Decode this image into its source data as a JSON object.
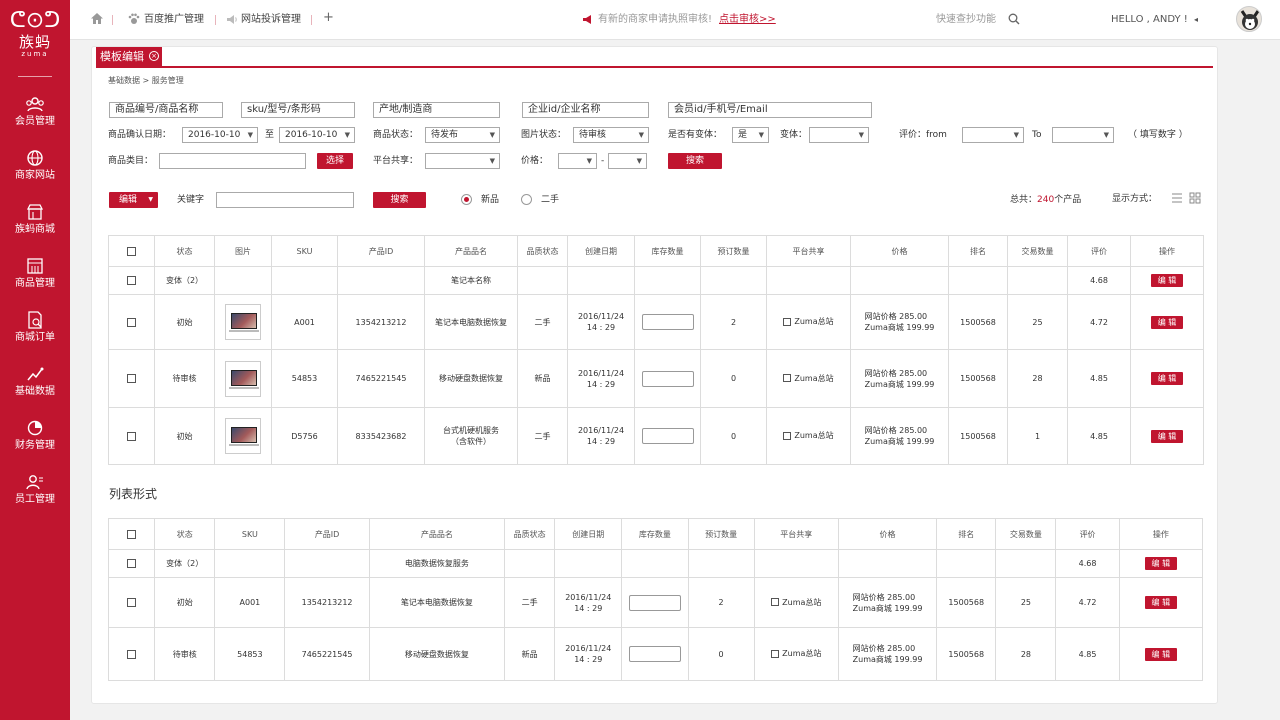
{
  "sidebar": {
    "logo": {
      "mark": "ᕦ⊙ᕤ",
      "name": "族蚂",
      "sub": "zuma"
    },
    "items": [
      {
        "label": "会员管理",
        "icon": "members-icon"
      },
      {
        "label": "商家网站",
        "icon": "globe-icon"
      },
      {
        "label": "族蚂商城",
        "icon": "mall-icon"
      },
      {
        "label": "商品管理",
        "icon": "grid-icon"
      },
      {
        "label": "商城订单",
        "icon": "order-icon"
      },
      {
        "label": "基础数据",
        "icon": "chart-icon"
      },
      {
        "label": "财务管理",
        "icon": "pie-icon"
      },
      {
        "label": "员工管理",
        "icon": "staff-icon"
      }
    ]
  },
  "topbar": {
    "nav1": "百度推广管理",
    "nav2": "网站投诉管理",
    "plus": "+",
    "notice": "有新的商家申请执照审核!",
    "notice_link": "点击审核>>",
    "search_placeholder": "快速查抄功能",
    "greeting": "HELLO , ANDY !",
    "colors": {
      "brand": "#c0152f"
    }
  },
  "tab": {
    "label": "模板编辑",
    "close": "×"
  },
  "breadcrumb": "基础数据 > 服务管理",
  "filters": {
    "search1": "商品编号/商品名称",
    "search2": "sku/型号/条形码",
    "search3": "产地/制造商",
    "search4": "企业id/企业名称",
    "search5": "会员id/手机号/Email",
    "confirm_date_label": "商品确认日期：",
    "date_from": "2016-10-10",
    "date_to_sep": "至",
    "date_to": "2016-10-10",
    "status_label": "商品状态：",
    "status_value": "待发布",
    "image_status_label": "图片状态：",
    "image_status_value": "待审核",
    "variant_label": "是否有变体：",
    "variant_value": "是",
    "variant2_label": "变体：",
    "variant2_value": "",
    "rating_label": "评价：from",
    "rating_from": "",
    "rating_to_label": "To",
    "rating_to": "",
    "rating_hint": "（ 填写数字 ）",
    "category_label": "商品类目：",
    "category_value": "",
    "select_btn": "选择",
    "platform_label": "平台共享：",
    "platform_value": "",
    "price_label": "价格：",
    "price_from": "",
    "price_sep": "-",
    "price_to": "",
    "search_btn": "搜索"
  },
  "toolbar": {
    "edit_btn": "编辑",
    "keyword_label": "关键字",
    "keyword_value": "",
    "search_btn": "搜索",
    "radio_new": "新品",
    "radio_used": "二手",
    "total_prefix": "总共：",
    "total_count": "240",
    "total_suffix": "个产品",
    "display_label": "显示方式："
  },
  "table1": {
    "headers": [
      "状态",
      "图片",
      "SKU",
      "产品ID",
      "产品品名",
      "品质状态",
      "创建日期",
      "库存数量",
      "预订数量",
      "平台共享",
      "价格",
      "排名",
      "交易数量",
      "评价",
      "操作"
    ],
    "variant_row": {
      "status": "变体（2）",
      "name": "笔记本名称",
      "rating": "4.68",
      "action": "编 辑"
    },
    "rows": [
      {
        "status": "初始",
        "sku": "A001",
        "pid": "1354213212",
        "name": "笔记本电脑数据恢复",
        "name2": "",
        "quality": "二手",
        "date": "2016/11/24",
        "time": "14 : 29",
        "reserve": "2",
        "share": "Zuma总站",
        "price1": "网站价格    285.00",
        "price2": "Zuma商城   199.99",
        "rank": "1500568",
        "trades": "25",
        "rating": "4.72",
        "action": "编 辑"
      },
      {
        "status": "待审核",
        "sku": "54853",
        "pid": "7465221545",
        "name": "移动硬盘数据恢复",
        "name2": "",
        "quality": "新品",
        "date": "2016/11/24",
        "time": "14 : 29",
        "reserve": "0",
        "share": "Zuma总站",
        "price1": "网站价格    285.00",
        "price2": "Zuma商城   199.99",
        "rank": "1500568",
        "trades": "28",
        "rating": "4.85",
        "action": "编 辑"
      },
      {
        "status": "初始",
        "sku": "D5756",
        "pid": "8335423682",
        "name": "台式机硬机服务",
        "name2": "（含软件）",
        "quality": "二手",
        "date": "2016/11/24",
        "time": "14 : 29",
        "reserve": "0",
        "share": "Zuma总站",
        "price1": "网站价格    285.00",
        "price2": "Zuma商城   199.99",
        "rank": "1500568",
        "trades": "1",
        "rating": "4.85",
        "action": "编 辑"
      }
    ]
  },
  "section2_title": "列表形式",
  "table2": {
    "headers": [
      "状态",
      "SKU",
      "产品ID",
      "产品品名",
      "品质状态",
      "创建日期",
      "库存数量",
      "预订数量",
      "平台共享",
      "价格",
      "排名",
      "交易数量",
      "评价",
      "操作"
    ],
    "variant_row": {
      "status": "变体（2）",
      "name": "电脑数据恢复服务",
      "rating": "4.68",
      "action": "编 辑"
    },
    "rows": [
      {
        "status": "初始",
        "sku": "A001",
        "pid": "1354213212",
        "name": "笔记本电脑数据恢复",
        "quality": "二手",
        "date": "2016/11/24",
        "time": "14 : 29",
        "reserve": "2",
        "share": "Zuma总站",
        "price1": "网站价格    285.00",
        "price2": "Zuma商城   199.99",
        "rank": "1500568",
        "trades": "25",
        "rating": "4.72",
        "action": "编 辑"
      },
      {
        "status": "待审核",
        "sku": "54853",
        "pid": "7465221545",
        "name": "移动硬盘数据恢复",
        "quality": "新品",
        "date": "2016/11/24",
        "time": "14 : 29",
        "reserve": "0",
        "share": "Zuma总站",
        "price1": "网站价格    285.00",
        "price2": "Zuma商城   199.99",
        "rank": "1500568",
        "trades": "28",
        "rating": "4.85",
        "action": "编 辑"
      }
    ]
  }
}
